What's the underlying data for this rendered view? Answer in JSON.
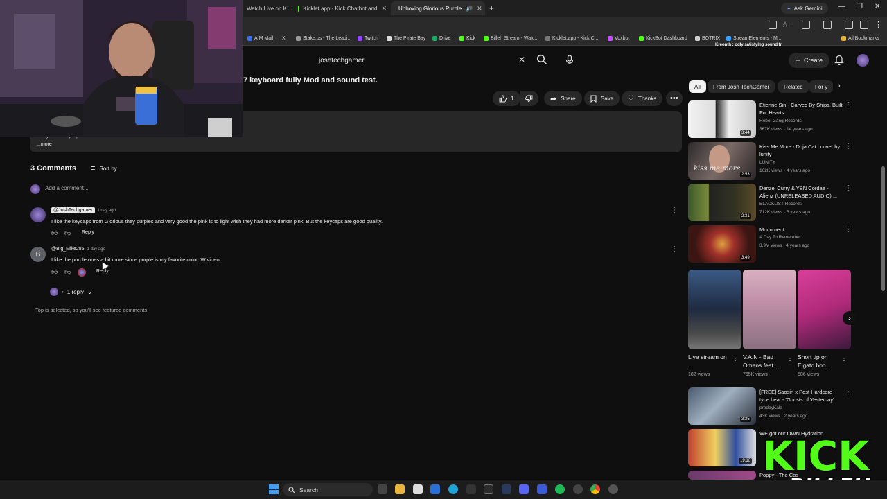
{
  "browser": {
    "tabs": [
      {
        "label": "Watch Live on K",
        "active": false
      },
      {
        "label": "Kicklet.app - Kick Chatbot and",
        "active": false
      },
      {
        "label": "Unboxing Glorious Purple",
        "active": true
      }
    ],
    "ask_gemini": "Ask Gemini",
    "bookmarks": [
      "AIM Mail",
      "X",
      "Stake.us - The Leadi...",
      "Twitch",
      "The Pirate Bay",
      "Drive",
      "Kick",
      "Billeh Stream - Watc...",
      "Kicklet.app - Kick C...",
      "Voxbot",
      "KickBot Dashboard",
      "BOTRIX",
      "StreamElements - M...",
      "All Bookmarks"
    ],
    "bookmark_overlay": "Kreonth : odly satisfying sound fr"
  },
  "youtube": {
    "search_value": "joshtechgamer",
    "create_label": "Create",
    "video_title": "7 keyboard fully Mod and sound test.",
    "actions": {
      "likes": "1",
      "share": "Share",
      "save": "Save",
      "thanks": "Thanks"
    },
    "description": {
      "text": "with glorious keycaps.",
      "more": "...more"
    },
    "comments": {
      "header": "3 Comments",
      "sort_by": "Sort by",
      "add_placeholder": "Add a comment...",
      "items": [
        {
          "handle": "@JoshTechgamer",
          "time": "1 day ago",
          "text": "I like the keycaps from Glorious they purples and very good the pink is to light wish they had more darker pink. But the keycaps are good quality.",
          "reply": "Reply"
        },
        {
          "handle": "@Big_Mike285",
          "avatar_letter": "B",
          "time": "1 day ago",
          "text": "I like the purple ones a bit more since purple is my favorite color. W video",
          "reply": "Reply",
          "replies_label": "1 reply"
        }
      ],
      "note": "Top is selected, so you'll see featured comments"
    }
  },
  "sidebar": {
    "chips": [
      "All",
      "From Josh TechGamer",
      "Related",
      "For y"
    ],
    "videos": [
      {
        "title": "Etienne Sin - Carved By Ships, Built For Hearts",
        "channel": "Rebel Gang Records",
        "meta": "367K views · 14 years ago",
        "duration": "3:44"
      },
      {
        "title": "Kiss Me More - Doja Cat | cover by lunity",
        "channel": "LUNITY",
        "meta": "102K views · 4 years ago",
        "duration": "2:53"
      },
      {
        "title": "Denzel Curry & YBN Cordae - Alienz (UNRELEASED AUDIO) ...",
        "channel": "BLACKLIST Records",
        "meta": "712K views · 5 years ago",
        "duration": "2:31"
      },
      {
        "title": "Monument",
        "channel": "A Day To Remember",
        "meta": "3.9M views · 4 years ago",
        "duration": "3:49"
      }
    ],
    "shorts": [
      {
        "title": "Live stream on ...",
        "views": "182 views"
      },
      {
        "title": "V.A.N - Bad Omens feat...",
        "views": "765K views"
      },
      {
        "title": "Short tip on Elgato boo...",
        "views": "586 views"
      }
    ],
    "videos2": [
      {
        "title": "[FREE] Saosin x Post Hardcore type beat - 'Ghosts of Yesterday'",
        "channel": "prodbyKala",
        "meta": "43K views · 2 years ago",
        "duration": "3:25"
      },
      {
        "title": "WE got our OWN Hydration",
        "channel": "",
        "meta": "",
        "duration": "19:10"
      },
      {
        "title": "Poppy - The Cos",
        "channel": "",
        "meta": "",
        "duration": ""
      }
    ]
  },
  "taskbar": {
    "search": "Search"
  },
  "overlay": {
    "kick_text": "KICK",
    "billeh_text": "BILLEH"
  }
}
